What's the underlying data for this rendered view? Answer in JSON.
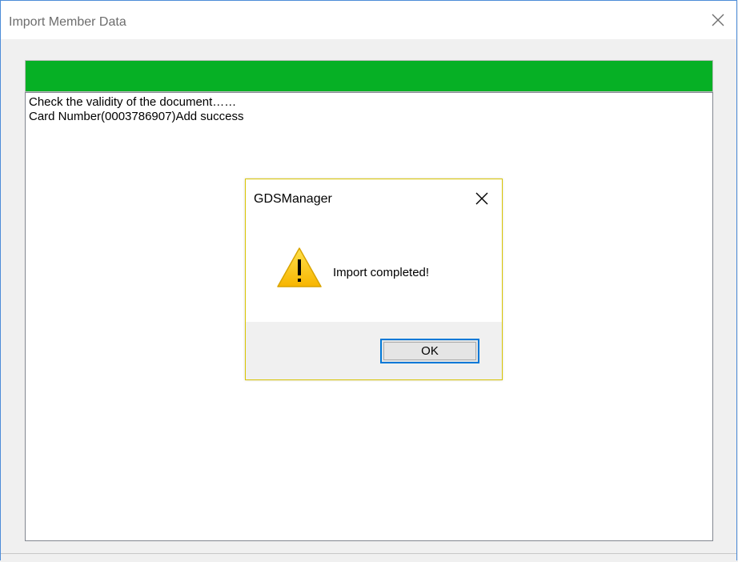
{
  "window": {
    "title": "Import Member Data",
    "close_icon": "close-icon"
  },
  "progress": {
    "fraction": 1.0,
    "color": "#06b025"
  },
  "log": {
    "lines": [
      "Check the validity of the document……",
      "Card Number(0003786907)Add success"
    ]
  },
  "dialog": {
    "title": "GDSManager",
    "close_icon": "close-icon",
    "icon": "warning-icon",
    "message": "Import completed!",
    "ok_label": "OK"
  },
  "colors": {
    "accent": "#0078d7",
    "window_border": "#4d8cd8",
    "dialog_border": "#d8c400",
    "warning": "#ffcc00"
  }
}
